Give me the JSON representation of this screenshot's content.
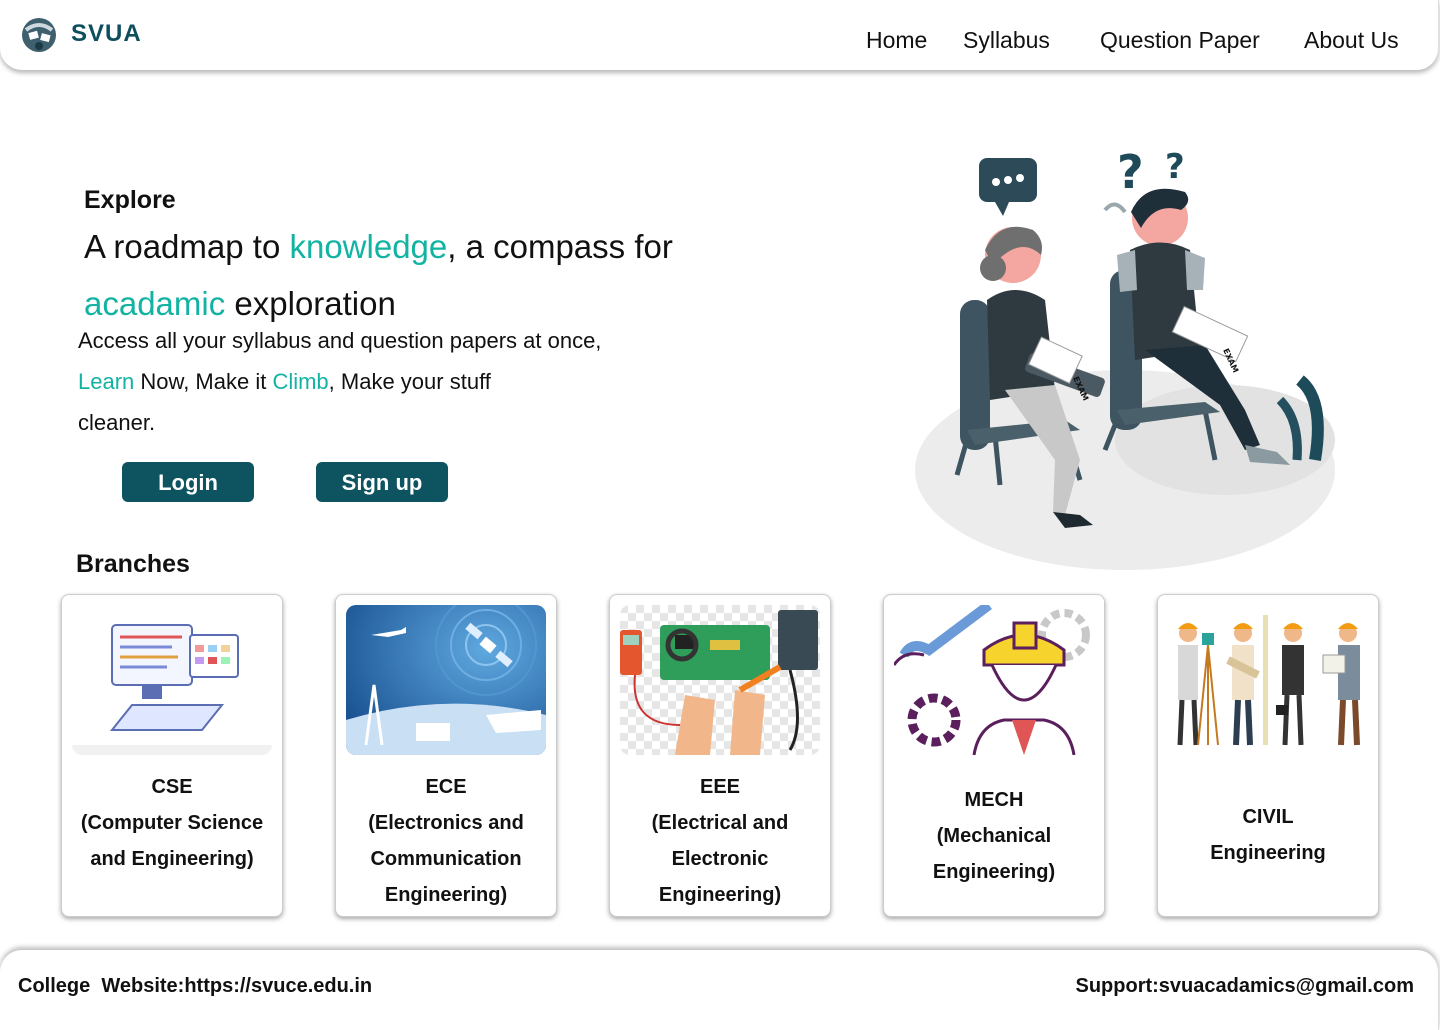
{
  "header": {
    "brand": "SVUA",
    "nav": [
      "Home",
      "Syllabus",
      "Question Paper",
      "About Us"
    ]
  },
  "hero": {
    "explore": "Explore",
    "headline_1": "A roadmap to ",
    "headline_highlight_1": "knowledge",
    "headline_2": ", a compass for",
    "headline_highlight_2": "acadamic",
    "headline_3": " exploration",
    "sub_1": "Access all your syllabus and question papers at once,",
    "sub_highlight_1": "Learn",
    "sub_2": " Now, Make it ",
    "sub_highlight_2": "Climb",
    "sub_3": ", Make your stuff",
    "sub_4": "cleaner.",
    "login_label": "Login",
    "signup_label": "Sign up",
    "illustration_exam_label": "EXAM"
  },
  "branches": {
    "title": "Branches",
    "items": [
      {
        "lines": [
          "CSE",
          "(Computer Science",
          "and Engineering)"
        ]
      },
      {
        "lines": [
          "ECE",
          "(Electronics and",
          "Communication",
          "Engineering)"
        ]
      },
      {
        "lines": [
          "EEE",
          "(Electrical and",
          "Electronic",
          "Engineering)"
        ]
      },
      {
        "lines": [
          "MECH",
          "(Mechanical",
          "Engineering)"
        ]
      },
      {
        "lines": [
          "CIVIL",
          "Engineering"
        ]
      }
    ]
  },
  "footer": {
    "left": "College  Website:https://svuce.edu.in",
    "right": "Support:svuacadamics@gmail.com"
  },
  "colors": {
    "brand": "#0d4f5c",
    "accent": "#13b3a3",
    "button": "#0d5460"
  }
}
